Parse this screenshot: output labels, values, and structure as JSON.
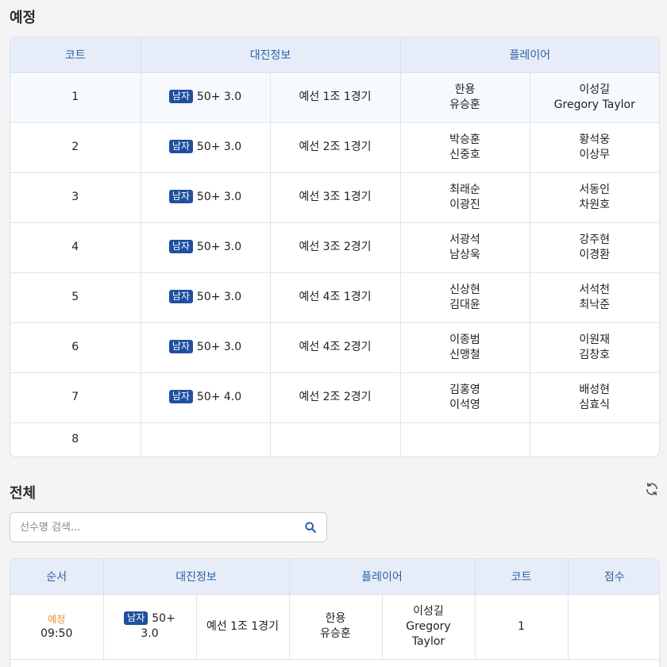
{
  "schedule": {
    "title": "예정",
    "headers": {
      "court": "코트",
      "match_info": "대진정보",
      "players": "플레이어"
    },
    "rows": [
      {
        "court": "1",
        "badge": "남자",
        "division": "50+ 3.0",
        "round": "예선 1조 1경기",
        "team1": [
          "한용",
          "유승훈"
        ],
        "team2": [
          "이성길",
          "Gregory Taylor"
        ]
      },
      {
        "court": "2",
        "badge": "남자",
        "division": "50+ 3.0",
        "round": "예선 2조 1경기",
        "team1": [
          "박승훈",
          "신중호"
        ],
        "team2": [
          "황석웅",
          "이상무"
        ]
      },
      {
        "court": "3",
        "badge": "남자",
        "division": "50+ 3.0",
        "round": "예선 3조 1경기",
        "team1": [
          "최래순",
          "이광진"
        ],
        "team2": [
          "서동인",
          "차원호"
        ]
      },
      {
        "court": "4",
        "badge": "남자",
        "division": "50+ 3.0",
        "round": "예선 3조 2경기",
        "team1": [
          "서광석",
          "남상욱"
        ],
        "team2": [
          "강주현",
          "이경환"
        ]
      },
      {
        "court": "5",
        "badge": "남자",
        "division": "50+ 3.0",
        "round": "예선 4조 1경기",
        "team1": [
          "신상현",
          "김대윤"
        ],
        "team2": [
          "서석천",
          "최낙준"
        ]
      },
      {
        "court": "6",
        "badge": "남자",
        "division": "50+ 3.0",
        "round": "예선 4조 2경기",
        "team1": [
          "이종범",
          "신맹철"
        ],
        "team2": [
          "이원재",
          "김창호"
        ]
      },
      {
        "court": "7",
        "badge": "남자",
        "division": "50+ 4.0",
        "round": "예선 2조 2경기",
        "team1": [
          "김홍영",
          "이석영"
        ],
        "team2": [
          "배성현",
          "심효식"
        ]
      },
      {
        "court": "8",
        "badge": "",
        "division": "",
        "round": "",
        "team1": [],
        "team2": []
      }
    ]
  },
  "all": {
    "title": "전체",
    "refresh_icon": "refresh-icon",
    "search": {
      "placeholder": "선수명 검색...",
      "value": "",
      "icon": "search-icon"
    },
    "headers": {
      "order": "순서",
      "match_info": "대진정보",
      "players": "플레이어",
      "court": "코트",
      "score": "점수"
    },
    "rows": [
      {
        "status": "예정",
        "time": "09:50",
        "badge": "남자",
        "division": "50+ 3.0",
        "round": "예선 1조 1경기",
        "team1": [
          "한용",
          "유승훈"
        ],
        "team2": [
          "이성길",
          "Gregory",
          "Taylor"
        ],
        "court": "1",
        "score": ""
      }
    ]
  },
  "colors": {
    "accent": "#1f4fa0",
    "header_bg": "#e6edf8",
    "header_text": "#2f5fa8",
    "status_pending": "#f08a24"
  }
}
